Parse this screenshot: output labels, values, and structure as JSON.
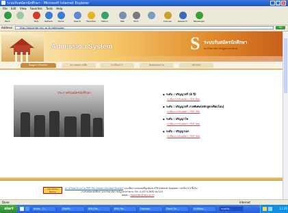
{
  "window": {
    "title": "ระบบรับสมัครนักศึกษา - Microsoft Internet Explorer",
    "controls": [
      "minimize",
      "maximize",
      "close"
    ]
  },
  "menu": [
    "File",
    "Edit",
    "View",
    "Favorites",
    "Tools",
    "Help"
  ],
  "toolbar": [
    {
      "label": "Back",
      "icon": "back-arrow-icon",
      "color": "#2f9e3a"
    },
    {
      "label": "",
      "icon": "forward-arrow-icon",
      "color": "#9cc99f"
    },
    {
      "label": "Stop",
      "icon": "stop-icon",
      "color": "#d03a2a"
    },
    {
      "label": "Refresh",
      "icon": "refresh-icon",
      "color": "#3a7bd5"
    },
    {
      "label": "Home",
      "icon": "home-icon",
      "color": "#3a7bd5"
    },
    {
      "label": "Search",
      "icon": "search-icon",
      "color": "#5a8ad0"
    },
    {
      "label": "Favorites",
      "icon": "favorites-star-icon",
      "color": "#e6b422"
    },
    {
      "label": "History",
      "icon": "history-icon",
      "color": "#3aa16a"
    },
    {
      "label": "Mail",
      "icon": "mail-icon",
      "color": "#7a8fb0"
    },
    {
      "label": "Print",
      "icon": "print-icon",
      "color": "#7a7a7a"
    },
    {
      "label": "",
      "icon": "edit-icon",
      "color": "#7a9ac0"
    },
    {
      "label": "Discuss",
      "icon": "discuss-icon",
      "color": "#c9a030"
    },
    {
      "label": "Research",
      "icon": "research-icon",
      "color": "#3a6abd"
    },
    {
      "label": "Messenger",
      "icon": "messenger-icon",
      "color": "#3aa13a"
    }
  ],
  "address": {
    "label": "Address",
    "url": "http://regcenter.rmu.ac.th/admission/",
    "go_label": "Go"
  },
  "site": {
    "title": "Admission System",
    "logo_letter": "S",
    "logo_th": "ระบบรับสมัครนักศึกษา",
    "logo_sub": "มหาวิทยาลัยราชภัฏมหาสารคาม"
  },
  "nav_tabs": [
    {
      "label": "ข้อมูลการรับสมัคร",
      "state": "active"
    },
    {
      "label": "ตรวจสอบรายชื่อ",
      "state": "inactive"
    },
    {
      "label": "ระเบียบการ",
      "state": "inactive"
    },
    {
      "label": "ติดต่อสอบถาม",
      "state": "inactive"
    },
    {
      "label": "หน้าหลัก",
      "state": "inactive"
    }
  ],
  "photo_caption": "ประกาศรับสมัครนักศึกษา",
  "links": [
    {
      "heading": "ระดับ : ปริญญาตรี (4 ปี)",
      "sub": "ระเบียบการรับสมัคร (.PDF file)"
    },
    {
      "heading": "ระดับ : ปริญญาตรี ภาคพิเศษ(หลักสูตรเทียบโอน)",
      "sub": "ระเบียบการรับสมัคร (.PDF file)"
    },
    {
      "heading": "ระดับ : ปริญญาโท",
      "sub": "ระเบียบการรับสมัคร (.PDF file)"
    },
    {
      "heading": "ระดับ : ปริญญาเอก",
      "sub": "ระเบียบการรับสมัคร (.PDF file)"
    }
  ],
  "footer": {
    "acrobat_label": "Get Adobe Reader",
    "line1_link": "ดาวน์โหลดโปรแกรม PDF File Viewer (Acrobat Reader)",
    "line1_text": " และเพื่อการแสดงผลที่ถูกต้องควรใช้ Internet Explorer เวอร์ชั่น 5.5 ขึ้นไป",
    "line2": "งานรับสมัครนักศึกษา มหาวิทยาลัยราชภัฏมหาสารคาม โทร. 0-4374-2630 ต่อ 123",
    "line3_prefix": "email : ",
    "line3_email": "regcenter@rmu.ac.th"
  },
  "status": {
    "left": "Done",
    "zone": "Internet"
  },
  "taskbar": {
    "start": "start",
    "tasks": [
      {
        "label": "Inbox - O...",
        "active": false
      },
      {
        "label": "DIAMS...",
        "active": false
      },
      {
        "label": "RMU Re...",
        "active": false
      },
      {
        "label": "RMU Re...",
        "active": false
      },
      {
        "label": "Desktop",
        "active": false
      },
      {
        "label": "Flash Dri...",
        "active": false
      },
      {
        "label": "Untitled...",
        "active": false
      },
      {
        "label": "ระบบรับ...",
        "active": true
      }
    ],
    "clock": "11:20"
  }
}
